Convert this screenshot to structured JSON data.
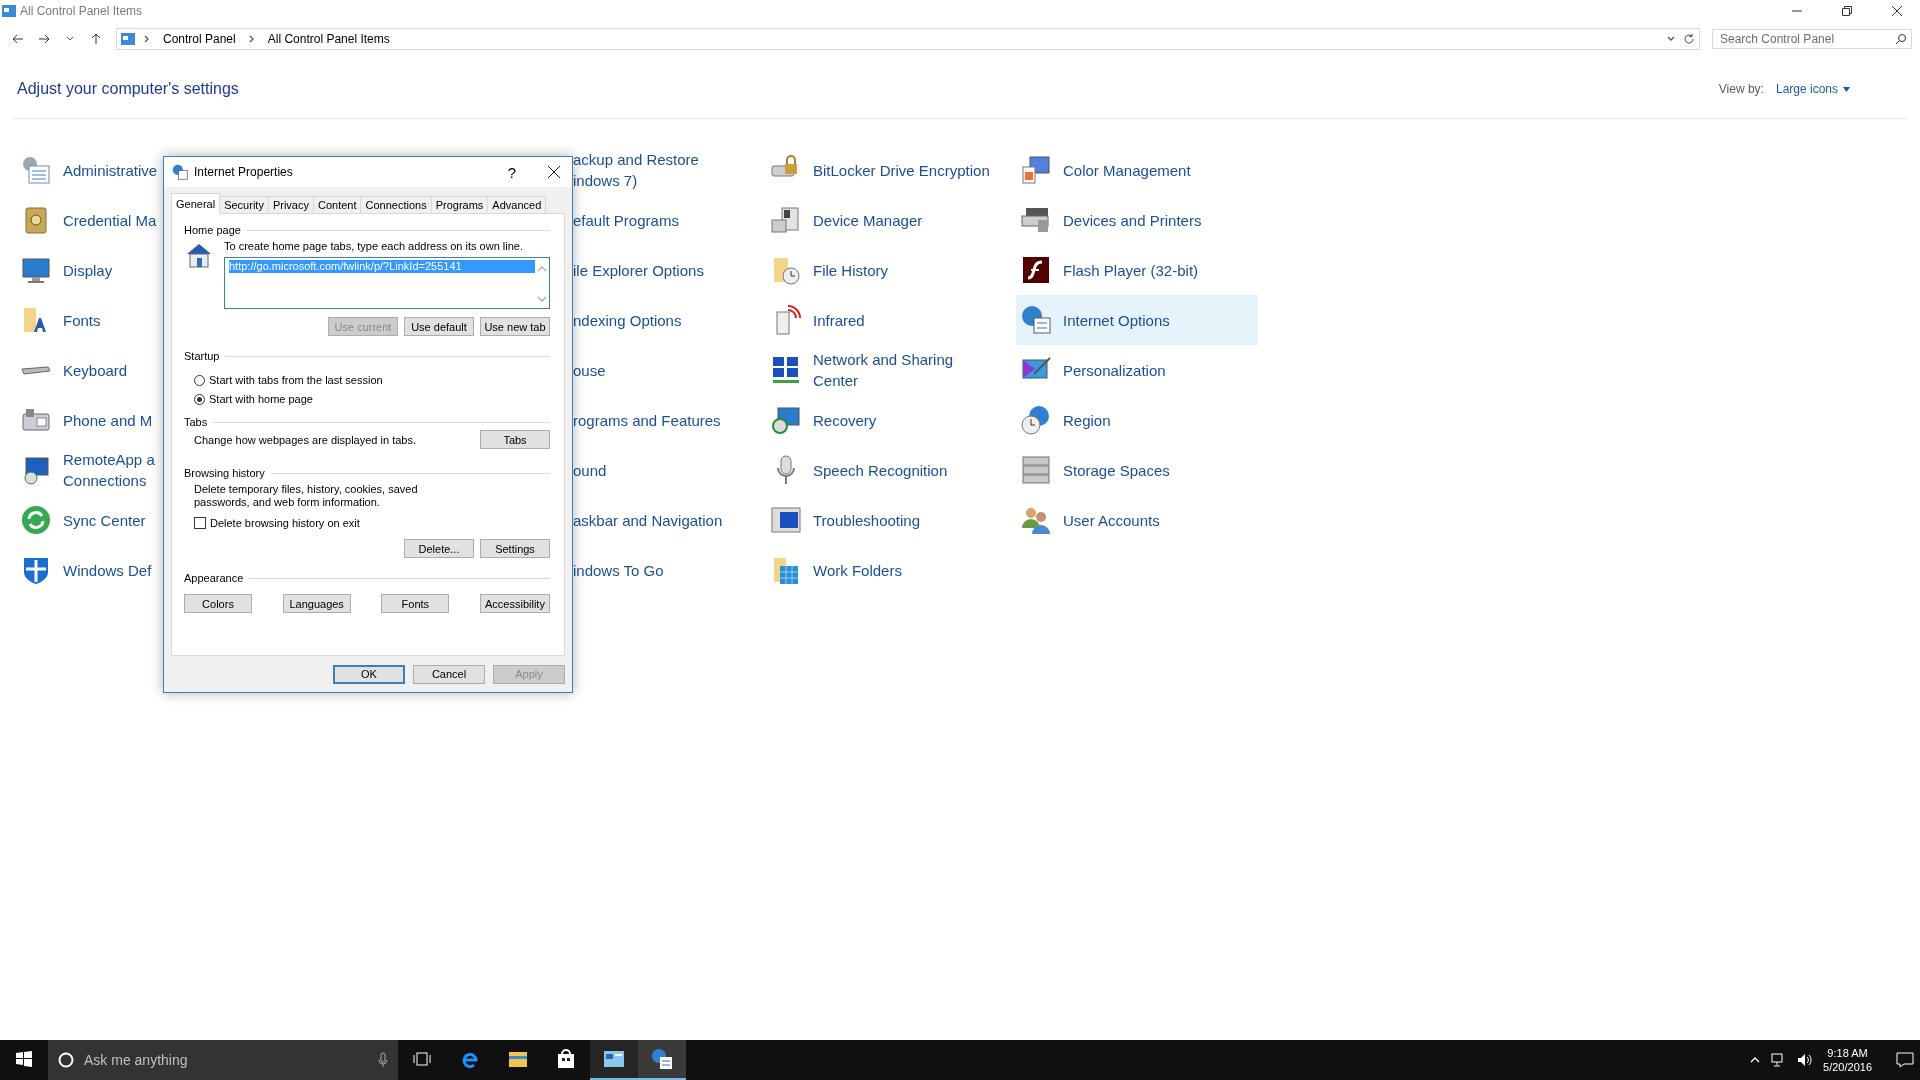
{
  "window": {
    "title": "All Control Panel Items"
  },
  "address_bar": {
    "breadcrumb": [
      "Control Panel",
      "All Control Panel Items"
    ]
  },
  "search": {
    "placeholder": "Search Control Panel"
  },
  "heading": "Adjust your computer's settings",
  "view_by": {
    "label": "View by:",
    "value": "Large icons"
  },
  "columns": [
    [
      {
        "label": "Administrative",
        "selected": false
      },
      {
        "label": "Credential Ma",
        "selected": false
      },
      {
        "label": "Display",
        "selected": false
      },
      {
        "label": "Fonts",
        "selected": false
      },
      {
        "label": "Keyboard",
        "selected": false
      },
      {
        "label": "Phone and M",
        "selected": false
      },
      {
        "label": "RemoteApp a\nConnections",
        "selected": false
      },
      {
        "label": "Sync Center",
        "selected": false
      },
      {
        "label": "Windows Def",
        "selected": false
      }
    ],
    [
      {
        "label": "ackup and Restore\nindows 7)",
        "selected": false
      },
      {
        "label": "efault Programs",
        "selected": false
      },
      {
        "label": "ile Explorer Options",
        "selected": false
      },
      {
        "label": "ndexing Options",
        "selected": false
      },
      {
        "label": "ouse",
        "selected": false
      },
      {
        "label": "rograms and Features",
        "selected": false
      },
      {
        "label": "ound",
        "selected": false
      },
      {
        "label": "askbar and Navigation",
        "selected": false
      },
      {
        "label": "indows To Go",
        "selected": false
      }
    ],
    [
      {
        "label": "BitLocker Drive Encryption",
        "selected": false
      },
      {
        "label": "Device Manager",
        "selected": false
      },
      {
        "label": "File History",
        "selected": false
      },
      {
        "label": "Infrared",
        "selected": false
      },
      {
        "label": "Network and Sharing\nCenter",
        "selected": false
      },
      {
        "label": "Recovery",
        "selected": false
      },
      {
        "label": "Speech Recognition",
        "selected": false
      },
      {
        "label": "Troubleshooting",
        "selected": false
      },
      {
        "label": "Work Folders",
        "selected": false
      }
    ],
    [
      {
        "label": "Color Management",
        "selected": false
      },
      {
        "label": "Devices and Printers",
        "selected": false
      },
      {
        "label": "Flash Player (32-bit)",
        "selected": false
      },
      {
        "label": "Internet Options",
        "selected": true
      },
      {
        "label": "Personalization",
        "selected": false
      },
      {
        "label": "Region",
        "selected": false
      },
      {
        "label": "Storage Spaces",
        "selected": false
      },
      {
        "label": "User Accounts",
        "selected": false
      }
    ]
  ],
  "dialog": {
    "title": "Internet Properties",
    "help": "?",
    "tabs": [
      {
        "label": "General",
        "selected": true
      },
      {
        "label": "Security",
        "selected": false
      },
      {
        "label": "Privacy",
        "selected": false
      },
      {
        "label": "Content",
        "selected": false
      },
      {
        "label": "Connections",
        "selected": false
      },
      {
        "label": "Programs",
        "selected": false
      },
      {
        "label": "Advanced",
        "selected": false
      }
    ],
    "home_page": {
      "legend": "Home page",
      "hint": "To create home page tabs, type each address on its own line.",
      "value": "http://go.microsoft.com/fwlink/p/?LinkId=255141",
      "buttons": [
        {
          "label": "Use current",
          "disabled": true
        },
        {
          "label": "Use default",
          "disabled": false
        },
        {
          "label": "Use new tab",
          "disabled": false
        }
      ]
    },
    "startup": {
      "legend": "Startup",
      "options": [
        {
          "label": "Start with tabs from the last session",
          "selected": false
        },
        {
          "label": "Start with home page",
          "selected": true
        }
      ]
    },
    "tabs_section": {
      "legend": "Tabs",
      "text": "Change how webpages are displayed in tabs.",
      "button": "Tabs"
    },
    "browsing_history": {
      "legend": "Browsing history",
      "text": "Delete temporary files, history, cookies, saved passwords, and web form information.",
      "checkbox": {
        "label": "Delete browsing history on exit",
        "checked": false
      },
      "buttons": [
        "Delete...",
        "Settings"
      ]
    },
    "appearance": {
      "legend": "Appearance",
      "buttons": [
        "Colors",
        "Languages",
        "Fonts",
        "Accessibility"
      ]
    },
    "footer_buttons": [
      {
        "label": "OK",
        "default": true,
        "disabled": false
      },
      {
        "label": "Cancel",
        "default": false,
        "disabled": false
      },
      {
        "label": "Apply",
        "default": false,
        "disabled": true
      }
    ]
  },
  "taskbar": {
    "search_placeholder": "Ask me anything",
    "apps": [
      {
        "open": false,
        "selected": false
      },
      {
        "open": false,
        "selected": false
      },
      {
        "open": false,
        "selected": false
      },
      {
        "open": true,
        "selected": false
      },
      {
        "open": true,
        "selected": true
      }
    ],
    "clock": {
      "time": "9:18 AM",
      "date": "5/20/2016"
    }
  }
}
